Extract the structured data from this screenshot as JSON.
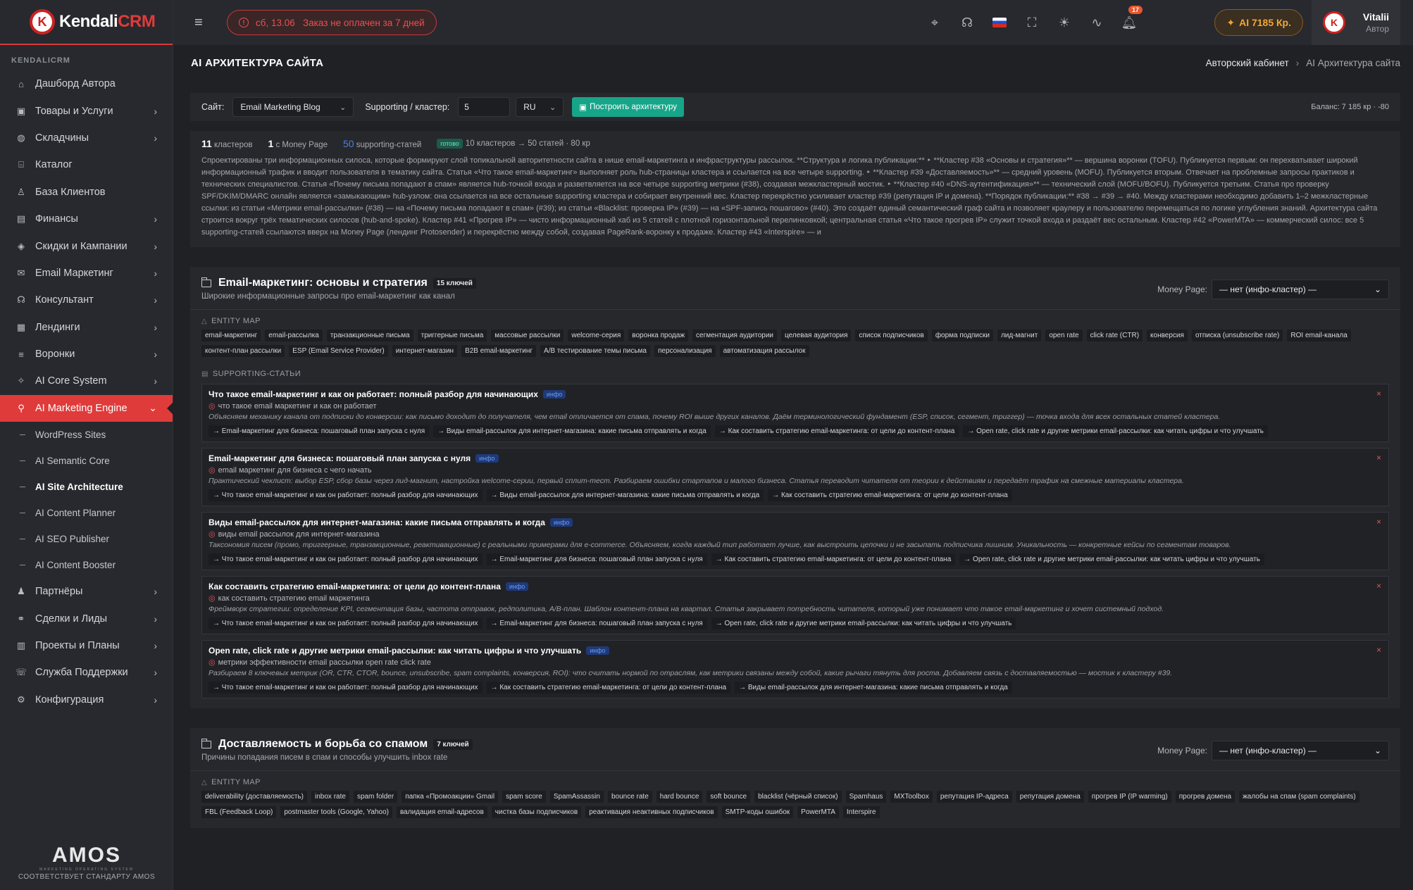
{
  "sidebar": {
    "section": "KENDALICRM",
    "logo_main": "Kendali",
    "logo_accent": "CRM",
    "items": [
      {
        "label": "Дашборд Автора",
        "icon": "home-icon",
        "chevron": false
      },
      {
        "label": "Товары и Услуги",
        "icon": "box-icon",
        "chevron": true
      },
      {
        "label": "Складчины",
        "icon": "globe-icon",
        "chevron": true
      },
      {
        "label": "Каталог",
        "icon": "store-icon",
        "chevron": false
      },
      {
        "label": "База Клиентов",
        "icon": "user-icon",
        "chevron": false
      },
      {
        "label": "Финансы",
        "icon": "wallet-icon",
        "chevron": true
      },
      {
        "label": "Скидки и Кампании",
        "icon": "tag-icon",
        "chevron": true
      },
      {
        "label": "Email Маркетинг",
        "icon": "mail-icon",
        "chevron": true
      },
      {
        "label": "Консультант",
        "icon": "headset-icon",
        "chevron": true
      },
      {
        "label": "Лендинги",
        "icon": "page-icon",
        "chevron": true
      },
      {
        "label": "Воронки",
        "icon": "filter-icon",
        "chevron": true
      },
      {
        "label": "AI Core System",
        "icon": "sparkle-icon",
        "chevron": true
      },
      {
        "label": "AI Marketing Engine",
        "icon": "rocket-icon",
        "chevron": true
      }
    ],
    "subitems": [
      {
        "label": "WordPress Sites"
      },
      {
        "label": "AI Semantic Core"
      },
      {
        "label": "AI Site Architecture"
      },
      {
        "label": "AI Content Planner"
      },
      {
        "label": "AI SEO Publisher"
      },
      {
        "label": "AI Content Booster"
      }
    ],
    "items_after": [
      {
        "label": "Партнёры",
        "icon": "users-icon",
        "chevron": true
      },
      {
        "label": "Сделки и Лиды",
        "icon": "handshake-icon",
        "chevron": true
      },
      {
        "label": "Проекты и Планы",
        "icon": "clipboard-icon",
        "chevron": true
      },
      {
        "label": "Служба Поддержки",
        "icon": "support-icon",
        "chevron": true
      },
      {
        "label": "Конфигурация",
        "icon": "gear-icon",
        "chevron": true
      }
    ],
    "footer_logo": "AMOS",
    "footer_sub": "MARKETING OPERATING SYSTEM",
    "footer_caption": "СООТВЕТСТВУЕТ СТАНДАРТУ AMOS"
  },
  "header": {
    "alert": "сб, 13.06   Заказ не оплачен за 7 дней",
    "notif_count": "17",
    "ai_balance": "AI 7185 Кр.",
    "user_name": "Vitalii",
    "user_role": "Автор"
  },
  "titlebar": {
    "title": "AI АРХИТЕКТУРА САЙТА",
    "crumb_home": "Авторский кабинет",
    "crumb_current": "AI Архитектура сайта"
  },
  "toolbar": {
    "site_label": "Сайт:",
    "site_value": "Email Marketing Blog",
    "supporting_label": "Supporting / кластер:",
    "supporting_value": "5",
    "lang_value": "RU",
    "build_button": "Построить архитектуру",
    "balance": "Баланс: 7 185 кр · -80"
  },
  "summary": {
    "clusters_num": "11",
    "clusters_label": "кластеров",
    "money_num": "1",
    "money_label": "с Money Page",
    "supporting_num": "50",
    "supporting_label": "supporting-статей",
    "ready": "готово",
    "ready_info": "10 кластеров → 50 статей · 80 кр",
    "text": "Спроектированы три информационных силоса, которые формируют слой топикальной авторитетности сайта в нише email-маркетинга и инфраструктуры рассылок. **Структура и логика публикации:** ‣ **Кластер #38 «Основы и стратегия»** — вершина воронки (TOFU). Публикуется первым: он перехватывает широкий информационный трафик и вводит пользователя в тематику сайта. Статья «Что такое email-маркетинг» выполняет роль hub-страницы кластера и ссылается на все четыре supporting. ‣ **Кластер #39 «Доставляемость»** — средний уровень (MOFU). Публикуется вторым. Отвечает на проблемные запросы практиков и технических специалистов. Статья «Почему письма попадают в спам» является hub-точкой входа и разветвляется на все четыре supporting метрики (#38), создавая межкластерный мостик. ‣ **Кластер #40 «DNS-аутентификация»** — технический слой (MOFU/BOFU). Публикуется третьим. Статья про проверку SPF/DKIM/DMARC онлайн является «замыкающим» hub-узлом: она ссылается на все остальные supporting кластера и собирает внутренний вес. Кластер перекрёстно усиливает кластер #39 (репутация IP и домена). **Порядок публикации:** #38 → #39 → #40. Между кластерами необходимо добавить 1–2 межкластерные ссылки: из статьи «Метрики email-рассылки» (#38) — на «Почему письма попадают в спам» (#39); из статьи «Blacklist: проверка IP» (#39) — на «SPF-запись пошагово» (#40). Это создаёт единый семантический граф сайта и позволяет краулеру и пользователю перемещаться по логике углубления знаний. Архитектура сайта строится вокруг трёх тематических силосов (hub-and-spoke). Кластер #41 «Прогрев IP» — чисто информационный хаб из 5 статей с плотной горизонтальной перелинковкой; центральная статья «Что такое прогрев IP» служит точкой входа и раздаёт вес остальным. Кластер #42 «PowerMTA» — коммерческий силос: все 5 supporting-статей ссылаются вверх на Money Page (лендинг Protosender) и перекрёстно между собой, создавая PageRank-воронку к продаже. Кластер #43 «Interspire» — и"
  },
  "labels": {
    "entity_map": "ENTITY MAP",
    "supporting": "SUPPORTING-СТАТЬИ",
    "money_page": "Money Page:"
  },
  "clusters": [
    {
      "title": "Email-маркетинг: основы и стратегия",
      "keys": "15 ключей",
      "subtitle": "Широкие информационные запросы про email-маркетинг как канал",
      "money_page": "— нет (инфо-кластер) —",
      "entities": [
        "email-маркетинг",
        "email-рассылка",
        "транзакционные письма",
        "триггерные письма",
        "массовые рассылки",
        "welcome-серия",
        "воронка продаж",
        "сегментация аудитории",
        "целевая аудитория",
        "список подписчиков",
        "форма подписки",
        "лид-магнит",
        "open rate",
        "click rate (CTR)",
        "конверсия",
        "отписка (unsubscribe rate)",
        "ROI email-канала",
        "контент-план рассылки",
        "ESP (Email Service Provider)",
        "интернет-магазин",
        "B2B email-маркетинг",
        "A/B тестирование темы письма",
        "персонализация",
        "автоматизация рассылок"
      ],
      "articles": [
        {
          "title": "Что такое email-маркетинг и как он работает: полный разбор для начинающих",
          "badge": "инфо",
          "keyword": "что такое email маркетинг и как он работает",
          "desc": "Объясняем механику канала от подписки до конверсии: как письмо доходит до получателя, чем email отличается от спама, почему ROI выше других каналов. Даём терминологический фундамент (ESP, список, сегмент, триггер) — точка входа для всех остальных статей кластера.",
          "links": [
            "→ Email-маркетинг для бизнеса: пошаговый план запуска с нуля",
            "→ Виды email-рассылок для интернет-магазина: какие письма отправлять и когда",
            "→ Как составить стратегию email-маркетинга: от цели до контент-плана",
            "→ Open rate, click rate и другие метрики email-рассылки: как читать цифры и что улучшать"
          ]
        },
        {
          "title": "Email-маркетинг для бизнеса: пошаговый план запуска с нуля",
          "badge": "инфо",
          "keyword": "email маркетинг для бизнеса с чего начать",
          "desc": "Практический чеклист: выбор ESP, сбор базы через лид-магнит, настройка welcome-серии, первый сплит-тест. Разбираем ошибки стартапов и малого бизнеса. Статья переводит читателя от теории к действиям и передаёт трафик на смежные материалы кластера.",
          "links": [
            "→ Что такое email-маркетинг и как он работает: полный разбор для начинающих",
            "→ Виды email-рассылок для интернет-магазина: какие письма отправлять и когда",
            "→ Как составить стратегию email-маркетинга: от цели до контент-плана"
          ]
        },
        {
          "title": "Виды email-рассылок для интернет-магазина: какие письма отправлять и когда",
          "badge": "инфо",
          "keyword": "виды email рассылок для интернет-магазина",
          "desc": "Таксономия писем (промо, триггерные, транзакционные, реактивационные) с реальными примерами для e-commerce. Объясняем, когда каждый тип работает лучше, как выстроить цепочки и не засыпать подписчика лишним. Уникальность — конкретные кейсы по сегментам товаров.",
          "links": [
            "→ Что такое email-маркетинг и как он работает: полный разбор для начинающих",
            "→ Email-маркетинг для бизнеса: пошаговый план запуска с нуля",
            "→ Как составить стратегию email-маркетинга: от цели до контент-плана",
            "→ Open rate, click rate и другие метрики email-рассылки: как читать цифры и что улучшать"
          ]
        },
        {
          "title": "Как составить стратегию email-маркетинга: от цели до контент-плана",
          "badge": "инфо",
          "keyword": "как составить стратегию email маркетинга",
          "desc": "Фреймворк стратегии: определение KPI, сегментация базы, частота отправок, редполитика, A/B-план. Шаблон контент-плана на квартал. Статья закрывает потребность читателя, который уже понимает что такое email-маркетинг и хочет системный подход.",
          "links": [
            "→ Что такое email-маркетинг и как он работает: полный разбор для начинающих",
            "→ Email-маркетинг для бизнеса: пошаговый план запуска с нуля",
            "→ Open rate, click rate и другие метрики email-рассылки: как читать цифры и что улучшать"
          ]
        },
        {
          "title": "Open rate, click rate и другие метрики email-рассылки: как читать цифры и что улучшать",
          "badge": "инфо",
          "keyword": "метрики эффективности email рассылки open rate click rate",
          "desc": "Разбираем 8 ключевых метрик (OR, CTR, CTOR, bounce, unsubscribe, spam complaints, конверсия, ROI): что считать нормой по отраслям, как метрики связаны между собой, какие рычаги тянуть для роста. Добавляем связь с доставляемостью — мостик к кластеру #39.",
          "links": [
            "→ Что такое email-маркетинг и как он работает: полный разбор для начинающих",
            "→ Как составить стратегию email-маркетинга: от цели до контент-плана",
            "→ Виды email-рассылок для интернет-магазина: какие письма отправлять и когда"
          ]
        }
      ]
    },
    {
      "title": "Доставляемость и борьба со спамом",
      "keys": "7 ключей",
      "subtitle": "Причины попадания писем в спам и способы улучшить inbox rate",
      "money_page": "— нет (инфо-кластер) —",
      "entities": [
        "deliverability (доставляемость)",
        "inbox rate",
        "spam folder",
        "папка «Промоакции» Gmail",
        "spam score",
        "SpamAssassin",
        "bounce rate",
        "hard bounce",
        "soft bounce",
        "blacklist (чёрный список)",
        "Spamhaus",
        "MXToolbox",
        "репутация IP-адреса",
        "репутация домена",
        "прогрев IP (IP warming)",
        "прогрев домена",
        "жалобы на спам (spam complaints)",
        "FBL (Feedback Loop)",
        "postmaster tools (Google, Yahoo)",
        "валидация email-адресов",
        "чистка базы подписчиков",
        "реактивация неактивных подписчиков",
        "SMTP-коды ошибок",
        "PowerMTA",
        "Interspire"
      ]
    }
  ]
}
